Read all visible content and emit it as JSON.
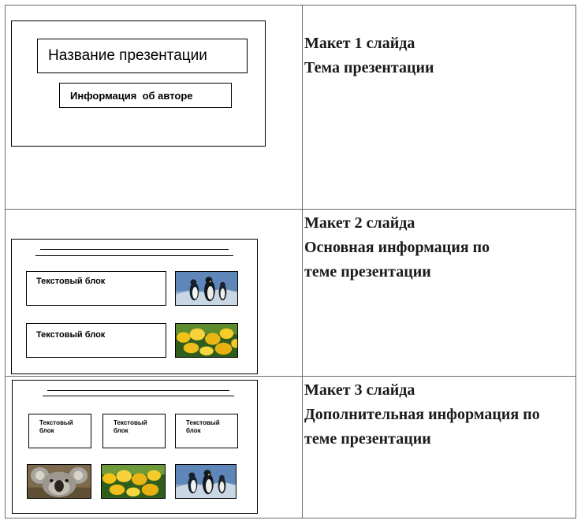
{
  "rows": [
    {
      "description": [
        "Макет 1 слайда",
        "Тема презентации"
      ],
      "slide": {
        "title_box": "Название презентации",
        "author_box": "Информация  об авторе"
      }
    },
    {
      "description": [
        "Макет 2 слайда",
        "Основная информация по",
        "теме презентации"
      ],
      "slide": {
        "text_boxes": [
          "Текстовый блок",
          "Текстовый блок"
        ],
        "images": [
          "penguins-image",
          "tulips-image"
        ]
      }
    },
    {
      "description": [
        "Макет 3 слайда",
        "Дополнительная информация по",
        "теме презентации"
      ],
      "slide": {
        "text_boxes": [
          [
            "Текстовый",
            "блок"
          ],
          [
            "Текстовый",
            "блок"
          ],
          [
            "Текстовый",
            "блок"
          ]
        ],
        "images": [
          "koala-image",
          "tulips-image",
          "penguins-image"
        ]
      }
    }
  ]
}
